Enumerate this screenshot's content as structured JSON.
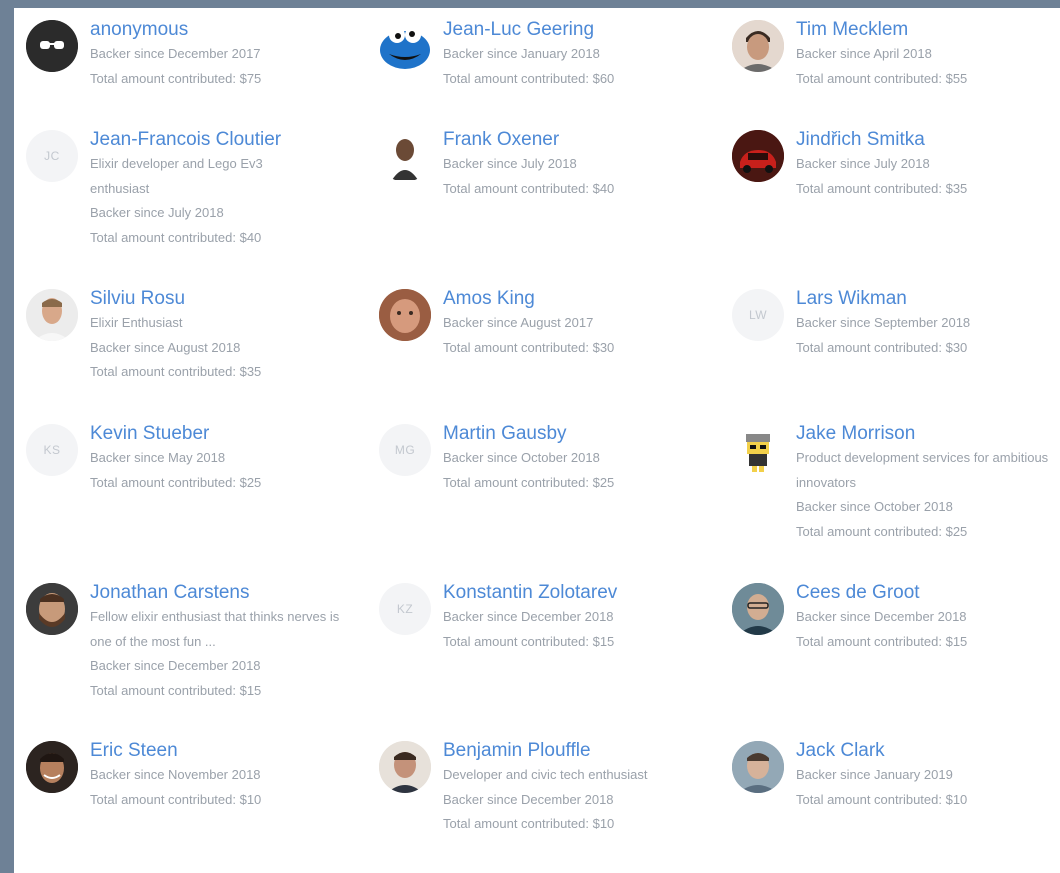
{
  "backers": [
    {
      "name": "anonymous",
      "initials": "",
      "icon": "sunglasses-icon",
      "description": "",
      "since": "Backer since December 2017",
      "total": "Total amount contributed: $75"
    },
    {
      "name": "Jean-Luc Geering",
      "initials": "",
      "icon": "cookie-monster-avatar",
      "description": "",
      "since": "Backer since January 2018",
      "total": "Total amount contributed: $60"
    },
    {
      "name": "Tim Mecklem",
      "initials": "",
      "icon": "person-photo-avatar",
      "description": "",
      "since": "Backer since April 2018",
      "total": "Total amount contributed: $55"
    },
    {
      "name": "Jean-Francois Cloutier",
      "initials": "JC",
      "icon": "",
      "description": "Elixir developer and Lego Ev3 enthusiast",
      "since": "Backer since July 2018",
      "total": "Total amount contributed: $40"
    },
    {
      "name": "Frank Oxener",
      "initials": "",
      "icon": "person-photo-avatar",
      "description": "",
      "since": "Backer since July 2018",
      "total": "Total amount contributed: $40"
    },
    {
      "name": "Jindřich Smitka",
      "initials": "",
      "icon": "red-car-avatar",
      "description": "",
      "since": "Backer since July 2018",
      "total": "Total amount contributed: $35"
    },
    {
      "name": "Silviu Rosu",
      "initials": "",
      "icon": "person-photo-avatar",
      "description": "Elixir Enthusiast",
      "since": "Backer since August 2018",
      "total": "Total amount contributed: $35"
    },
    {
      "name": "Amos King",
      "initials": "",
      "icon": "person-photo-avatar",
      "description": "",
      "since": "Backer since August 2017",
      "total": "Total amount contributed: $30"
    },
    {
      "name": "Lars Wikman",
      "initials": "LW",
      "icon": "",
      "description": "",
      "since": "Backer since September 2018",
      "total": "Total amount contributed: $30"
    },
    {
      "name": "Kevin Stueber",
      "initials": "KS",
      "icon": "",
      "description": "",
      "since": "Backer since May 2018",
      "total": "Total amount contributed: $25"
    },
    {
      "name": "Martin Gausby",
      "initials": "MG",
      "icon": "",
      "description": "",
      "since": "Backer since October 2018",
      "total": "Total amount contributed: $25"
    },
    {
      "name": "Jake Morrison",
      "initials": "",
      "icon": "cartoon-character-avatar",
      "description": "Product development services for ambitious innovators",
      "since": "Backer since October 2018",
      "total": "Total amount contributed: $25"
    },
    {
      "name": "Jonathan Carstens",
      "initials": "",
      "icon": "person-photo-avatar",
      "description": "Fellow elixir enthusiast that thinks nerves is one of the most fun ...",
      "since": "Backer since December 2018",
      "total": "Total amount contributed: $15"
    },
    {
      "name": "Konstantin Zolotarev",
      "initials": "KZ",
      "icon": "",
      "description": "",
      "since": "Backer since December 2018",
      "total": "Total amount contributed: $15"
    },
    {
      "name": "Cees de Groot",
      "initials": "",
      "icon": "person-photo-avatar",
      "description": "",
      "since": "Backer since December 2018",
      "total": "Total amount contributed: $15"
    },
    {
      "name": "Eric Steen",
      "initials": "",
      "icon": "person-photo-avatar",
      "description": "",
      "since": "Backer since November 2018",
      "total": "Total amount contributed: $10"
    },
    {
      "name": "Benjamin Plouffle",
      "initials": "",
      "icon": "person-photo-avatar",
      "description": "Developer and civic tech enthusiast",
      "since": "Backer since December 2018",
      "total": "Total amount contributed: $10"
    },
    {
      "name": "Jack Clark",
      "initials": "",
      "icon": "person-photo-avatar",
      "description": "",
      "since": "Backer since January 2019",
      "total": "Total amount contributed: $10"
    }
  ],
  "colors": {
    "link": "#4d89d6",
    "muted": "#9aa1aa",
    "frame": "#6e8196"
  }
}
